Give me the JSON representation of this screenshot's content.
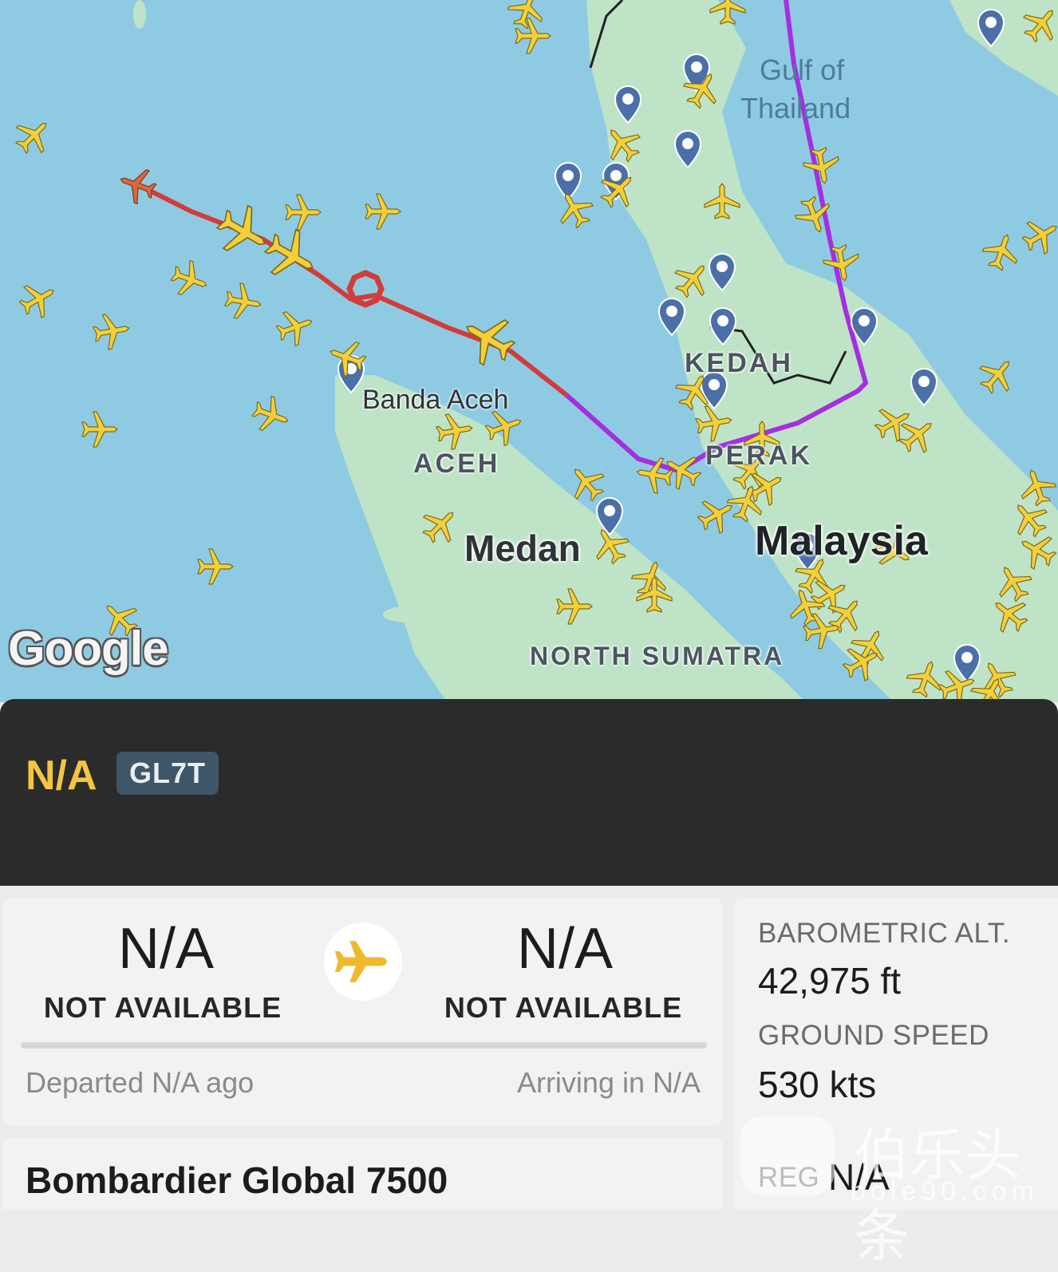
{
  "map": {
    "labels": {
      "gulf_line1": "Gulf of",
      "gulf_line2": "Thailand",
      "kedah": "KEDAH",
      "perak": "PERAK",
      "aceh": "ACEH",
      "banda_aceh": "Banda Aceh",
      "medan": "Medan",
      "malaysia": "Malaysia",
      "north_sumatra": "NORTH SUMATRA"
    },
    "logo": "Google",
    "colors": {
      "water": "#8ecbe3",
      "land": "#bfe3c6",
      "track_red": "#d23c3a",
      "track_purple": "#a52ee0",
      "aircraft": "#f3d03a",
      "pin": "#4b6fa8"
    }
  },
  "flight": {
    "callsign": "N/A",
    "aircraft_type_code": "GL7T"
  },
  "route": {
    "origin_code": "N/A",
    "origin_name": "NOT AVAILABLE",
    "destination_code": "N/A",
    "destination_name": "NOT AVAILABLE",
    "departed": "Departed N/A ago",
    "arriving": "Arriving in N/A",
    "icon": "airplane-icon"
  },
  "stats": {
    "baro_alt_label": "BAROMETRIC ALT.",
    "baro_alt_value": "42,975 ft",
    "ground_speed_label": "GROUND SPEED",
    "ground_speed_value": "530 kts",
    "reg_label": "REG",
    "reg_value": "N/A"
  },
  "aircraft": {
    "model": "Bombardier Global 7500"
  },
  "watermark": {
    "text": "伯乐头条",
    "url": "bole90.com"
  }
}
